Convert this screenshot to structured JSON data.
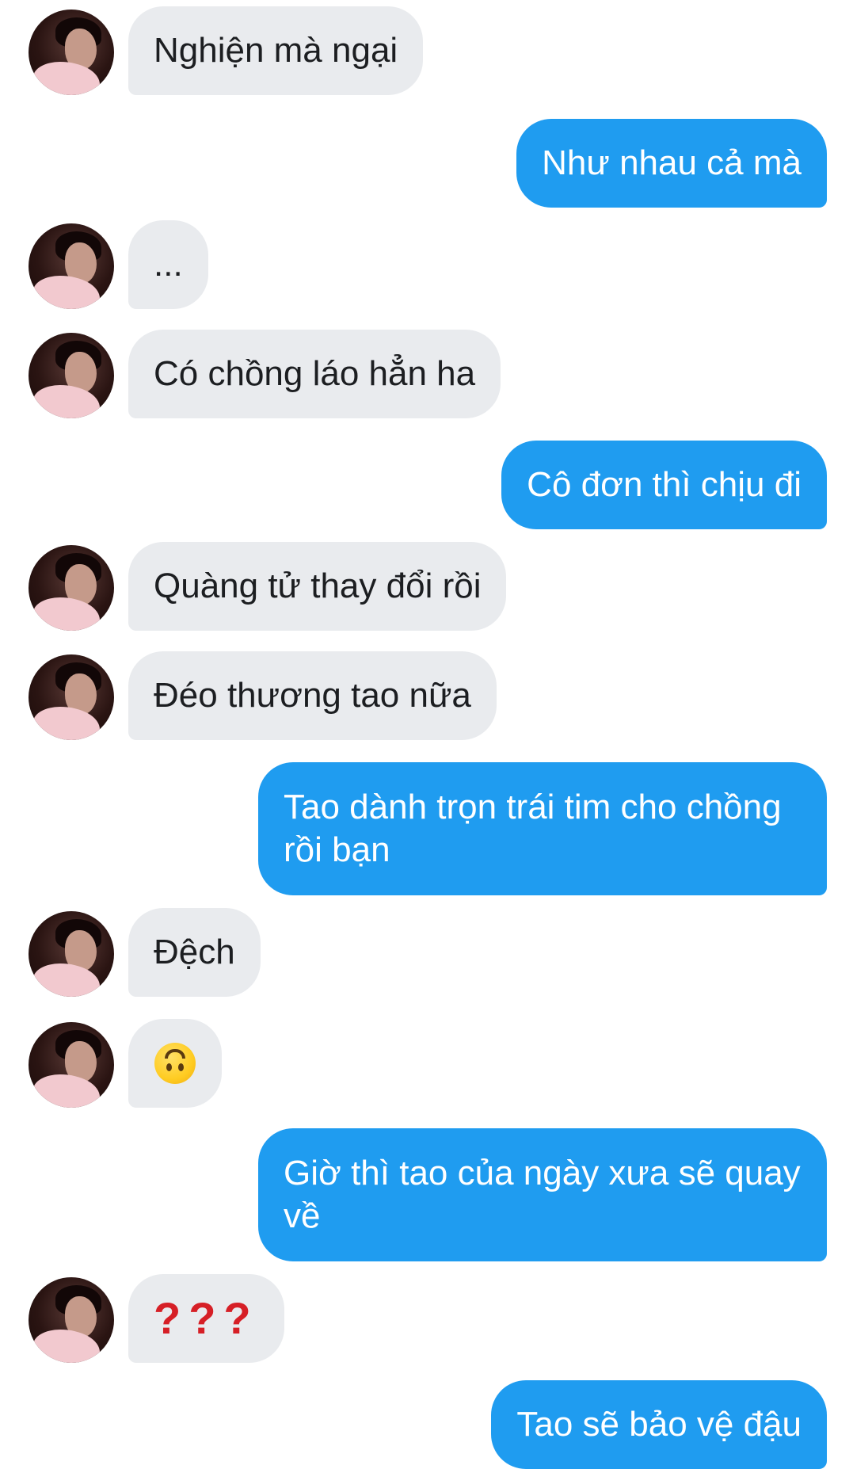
{
  "messages": [
    {
      "side": "in",
      "text": "Nghiện mà ngại"
    },
    {
      "side": "out",
      "text": "Như nhau cả mà"
    },
    {
      "side": "in",
      "text": "..."
    },
    {
      "side": "in",
      "text": "Có chồng láo hẳn ha"
    },
    {
      "side": "out",
      "text": "Cô đơn thì chịu đi"
    },
    {
      "side": "in",
      "text": "Quàng tử thay đổi rồi"
    },
    {
      "side": "in",
      "text": "Đéo thương tao nữa"
    },
    {
      "side": "out",
      "text": "Tao dành trọn trái tim cho chồng rồi bạn"
    },
    {
      "side": "in",
      "text": "Đệch"
    },
    {
      "side": "in",
      "text": "",
      "icon": "upside-down-face-emoji"
    },
    {
      "side": "out",
      "text": "Giờ thì tao của ngày xưa sẽ quay về"
    },
    {
      "side": "in",
      "text": "???",
      "icon": "red-question-marks-emoji"
    },
    {
      "side": "out",
      "text": "Tao sẽ bảo vệ đậu"
    }
  ],
  "colors": {
    "incoming_bubble": "#e9ebee",
    "outgoing_bubble": "#1f9cf0",
    "incoming_text": "#1c1e21",
    "outgoing_text": "#ffffff"
  }
}
